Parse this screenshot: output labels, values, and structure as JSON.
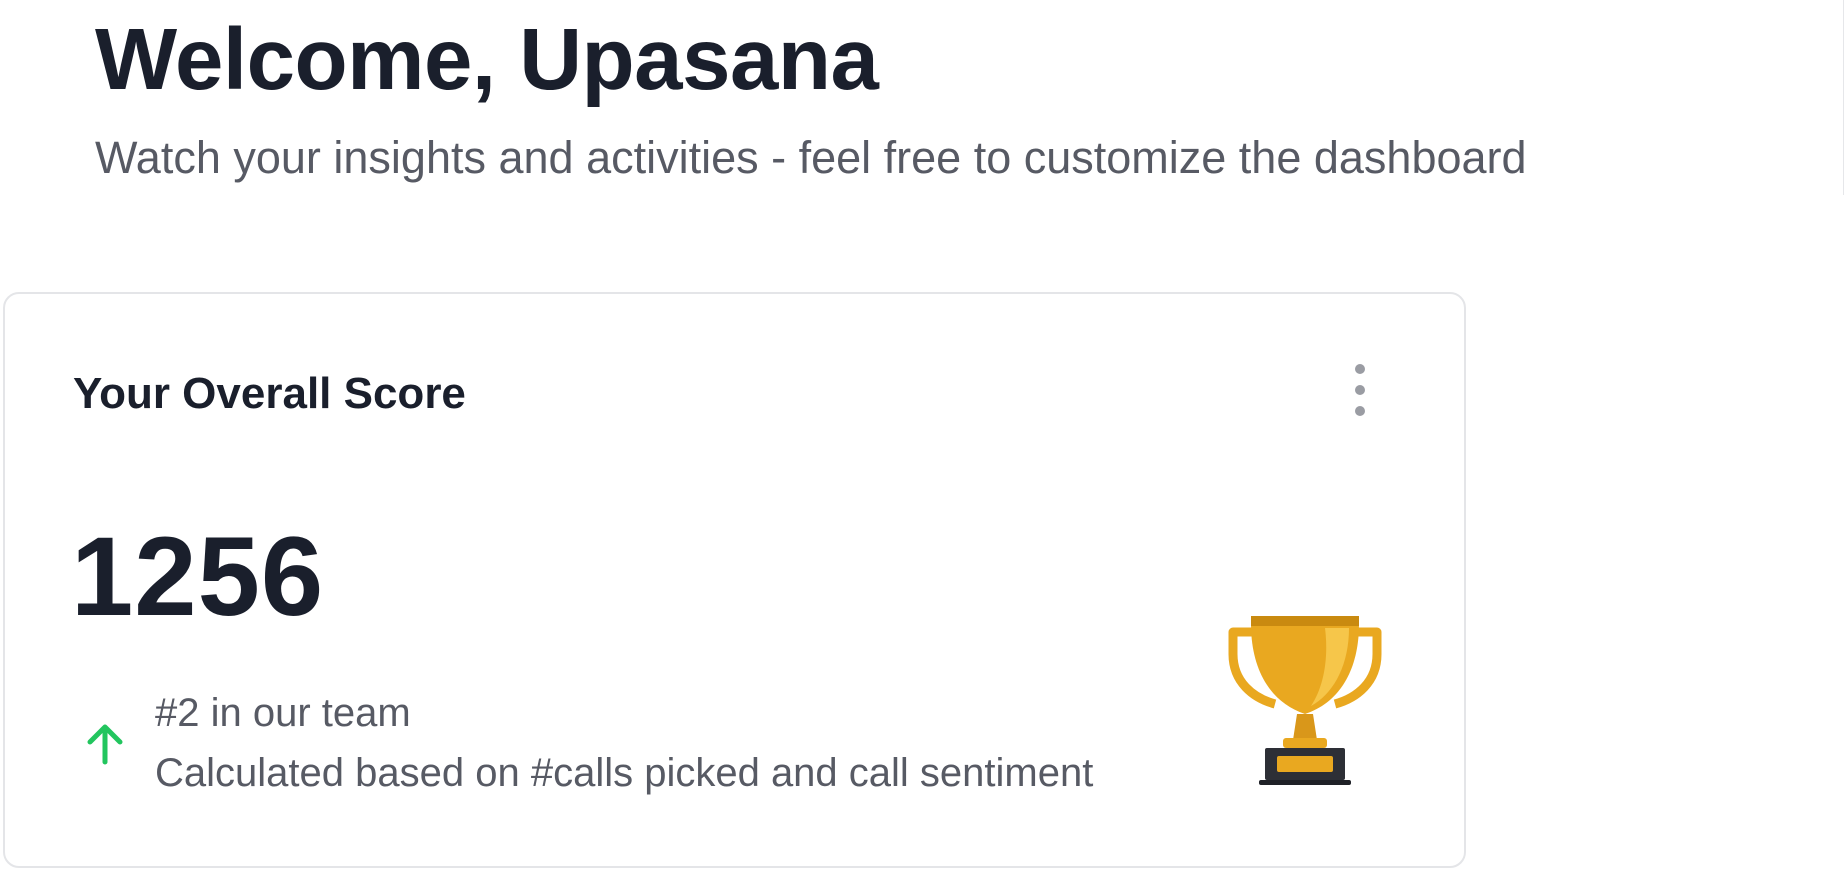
{
  "header": {
    "title": "Welcome, Upasana",
    "subtitle": "Watch your insights and activities - feel free to customize the dashboard"
  },
  "score_card": {
    "title": "Your Overall Score",
    "score": "1256",
    "rank_text": "#2 in our team",
    "description": "Calculated based on #calls picked and call sentiment",
    "menu_icon": "kebab-menu-icon",
    "trend_icon": "arrow-up-icon",
    "illustration": "trophy-icon"
  },
  "colors": {
    "text_primary": "#1a1f2c",
    "text_secondary": "#575a64",
    "trend_up": "#22c55e",
    "trophy_gold": "#e9a820",
    "card_border": "#e4e5e8"
  }
}
